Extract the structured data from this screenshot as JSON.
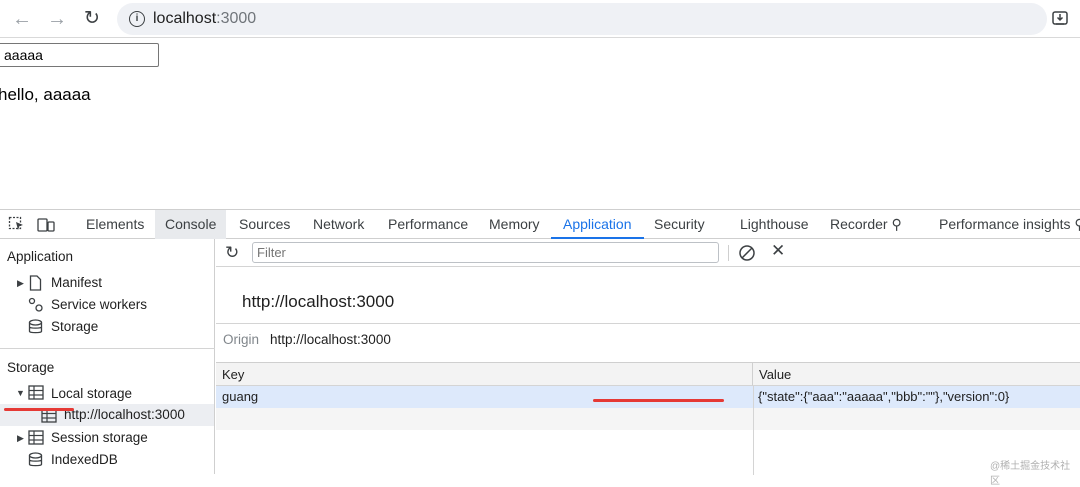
{
  "browser": {
    "back_icon": "arrow-left-icon",
    "forward_icon": "arrow-right-icon",
    "reload_icon": "reload-icon",
    "url_host": "localhost",
    "url_port": ":3000"
  },
  "page": {
    "input_value": "aaaaa",
    "greeting": "hello, aaaaa"
  },
  "devtools": {
    "tabs": [
      "Elements",
      "Console",
      "Sources",
      "Network",
      "Performance",
      "Memory",
      "Application",
      "Security",
      "Lighthouse",
      "Recorder",
      "Performance insights"
    ],
    "active_tab": "Application",
    "sidebar": {
      "application_heading": "Application",
      "manifest": "Manifest",
      "service_workers": "Service workers",
      "storage_item": "Storage",
      "storage_heading": "Storage",
      "local_storage": "Local storage",
      "local_storage_origin": "http://localhost:3000",
      "session_storage": "Session storage",
      "indexeddb": "IndexedDB"
    },
    "toolbar": {
      "filter_placeholder": "Filter"
    },
    "main": {
      "origin_title": "http://localhost:3000",
      "origin_label": "Origin",
      "origin_value": "http://localhost:3000",
      "columns": [
        "Key",
        "Value"
      ],
      "rows": [
        {
          "key": "guang",
          "value": "{\"state\":{\"aaa\":\"aaaaa\",\"bbb\":\"\"},\"version\":0}"
        }
      ]
    }
  },
  "watermark": "@稀土掘金技术社区",
  "colors": {
    "accent": "#1a73e8",
    "selected_row": "#dde9fb",
    "annotation": "#e53935"
  }
}
